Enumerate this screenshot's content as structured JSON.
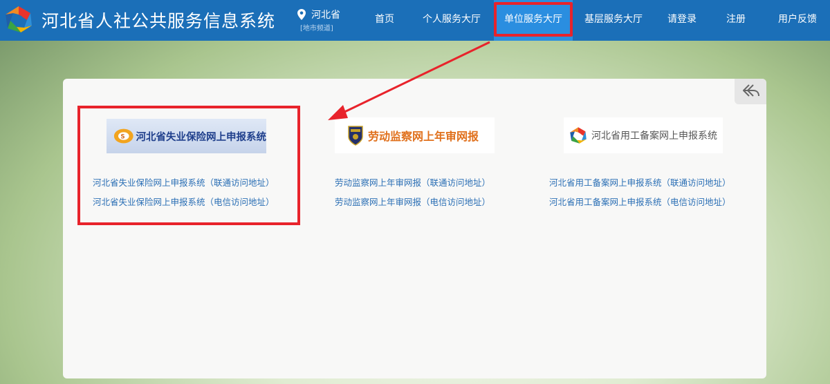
{
  "header": {
    "title": "河北省人社公共服务信息系统",
    "region": "河北省",
    "region_sub": "[地市频道]"
  },
  "nav": [
    {
      "label": "首页"
    },
    {
      "label": "个人服务大厅"
    },
    {
      "label": "单位服务大厅"
    },
    {
      "label": "基层服务大厅"
    },
    {
      "label": "请登录"
    },
    {
      "label": "注册"
    },
    {
      "label": "用户反馈"
    }
  ],
  "systems": [
    {
      "logo_text": "河北省失业保险网上申报系统",
      "link_unicom": "河北省失业保险网上申报系统（联通访问地址）",
      "link_telecom": "河北省失业保险网上申报系统（电信访问地址）"
    },
    {
      "logo_text": "劳动监察网上年审网报",
      "link_unicom": "劳动监察网上年审网报（联通访问地址）",
      "link_telecom": "劳动监察网上年审网报（电信访问地址）"
    },
    {
      "logo_text": "河北省用工备案网上申报系统",
      "link_unicom": "河北省用工备案网上申报系统（联通访问地址）",
      "link_telecom": "河北省用工备案网上申报系统（电信访问地址）"
    }
  ],
  "colors": {
    "header_bg": "#1b6fb8",
    "active_nav_bg": "#2a8ee0",
    "annotation_red": "#e8232b",
    "link": "#2b6fb5"
  },
  "icons": {
    "site_logo": "site-logo-icon",
    "location": "location-pin-icon",
    "back": "back-arrow-icon"
  }
}
